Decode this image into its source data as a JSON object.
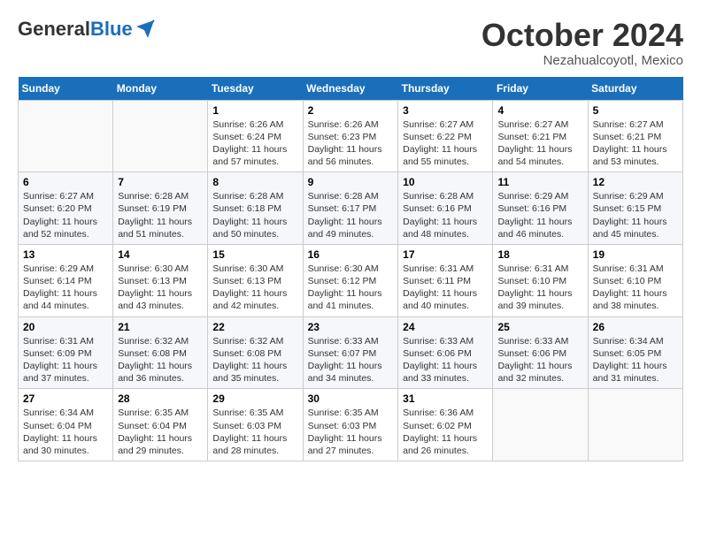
{
  "header": {
    "logo_general": "General",
    "logo_blue": "Blue",
    "month": "October 2024",
    "location": "Nezahualcoyotl, Mexico"
  },
  "days_of_week": [
    "Sunday",
    "Monday",
    "Tuesday",
    "Wednesday",
    "Thursday",
    "Friday",
    "Saturday"
  ],
  "weeks": [
    [
      {
        "day": "",
        "info": ""
      },
      {
        "day": "",
        "info": ""
      },
      {
        "day": "1",
        "info": "Sunrise: 6:26 AM\nSunset: 6:24 PM\nDaylight: 11 hours and 57 minutes."
      },
      {
        "day": "2",
        "info": "Sunrise: 6:26 AM\nSunset: 6:23 PM\nDaylight: 11 hours and 56 minutes."
      },
      {
        "day": "3",
        "info": "Sunrise: 6:27 AM\nSunset: 6:22 PM\nDaylight: 11 hours and 55 minutes."
      },
      {
        "day": "4",
        "info": "Sunrise: 6:27 AM\nSunset: 6:21 PM\nDaylight: 11 hours and 54 minutes."
      },
      {
        "day": "5",
        "info": "Sunrise: 6:27 AM\nSunset: 6:21 PM\nDaylight: 11 hours and 53 minutes."
      }
    ],
    [
      {
        "day": "6",
        "info": "Sunrise: 6:27 AM\nSunset: 6:20 PM\nDaylight: 11 hours and 52 minutes."
      },
      {
        "day": "7",
        "info": "Sunrise: 6:28 AM\nSunset: 6:19 PM\nDaylight: 11 hours and 51 minutes."
      },
      {
        "day": "8",
        "info": "Sunrise: 6:28 AM\nSunset: 6:18 PM\nDaylight: 11 hours and 50 minutes."
      },
      {
        "day": "9",
        "info": "Sunrise: 6:28 AM\nSunset: 6:17 PM\nDaylight: 11 hours and 49 minutes."
      },
      {
        "day": "10",
        "info": "Sunrise: 6:28 AM\nSunset: 6:16 PM\nDaylight: 11 hours and 48 minutes."
      },
      {
        "day": "11",
        "info": "Sunrise: 6:29 AM\nSunset: 6:16 PM\nDaylight: 11 hours and 46 minutes."
      },
      {
        "day": "12",
        "info": "Sunrise: 6:29 AM\nSunset: 6:15 PM\nDaylight: 11 hours and 45 minutes."
      }
    ],
    [
      {
        "day": "13",
        "info": "Sunrise: 6:29 AM\nSunset: 6:14 PM\nDaylight: 11 hours and 44 minutes."
      },
      {
        "day": "14",
        "info": "Sunrise: 6:30 AM\nSunset: 6:13 PM\nDaylight: 11 hours and 43 minutes."
      },
      {
        "day": "15",
        "info": "Sunrise: 6:30 AM\nSunset: 6:13 PM\nDaylight: 11 hours and 42 minutes."
      },
      {
        "day": "16",
        "info": "Sunrise: 6:30 AM\nSunset: 6:12 PM\nDaylight: 11 hours and 41 minutes."
      },
      {
        "day": "17",
        "info": "Sunrise: 6:31 AM\nSunset: 6:11 PM\nDaylight: 11 hours and 40 minutes."
      },
      {
        "day": "18",
        "info": "Sunrise: 6:31 AM\nSunset: 6:10 PM\nDaylight: 11 hours and 39 minutes."
      },
      {
        "day": "19",
        "info": "Sunrise: 6:31 AM\nSunset: 6:10 PM\nDaylight: 11 hours and 38 minutes."
      }
    ],
    [
      {
        "day": "20",
        "info": "Sunrise: 6:31 AM\nSunset: 6:09 PM\nDaylight: 11 hours and 37 minutes."
      },
      {
        "day": "21",
        "info": "Sunrise: 6:32 AM\nSunset: 6:08 PM\nDaylight: 11 hours and 36 minutes."
      },
      {
        "day": "22",
        "info": "Sunrise: 6:32 AM\nSunset: 6:08 PM\nDaylight: 11 hours and 35 minutes."
      },
      {
        "day": "23",
        "info": "Sunrise: 6:33 AM\nSunset: 6:07 PM\nDaylight: 11 hours and 34 minutes."
      },
      {
        "day": "24",
        "info": "Sunrise: 6:33 AM\nSunset: 6:06 PM\nDaylight: 11 hours and 33 minutes."
      },
      {
        "day": "25",
        "info": "Sunrise: 6:33 AM\nSunset: 6:06 PM\nDaylight: 11 hours and 32 minutes."
      },
      {
        "day": "26",
        "info": "Sunrise: 6:34 AM\nSunset: 6:05 PM\nDaylight: 11 hours and 31 minutes."
      }
    ],
    [
      {
        "day": "27",
        "info": "Sunrise: 6:34 AM\nSunset: 6:04 PM\nDaylight: 11 hours and 30 minutes."
      },
      {
        "day": "28",
        "info": "Sunrise: 6:35 AM\nSunset: 6:04 PM\nDaylight: 11 hours and 29 minutes."
      },
      {
        "day": "29",
        "info": "Sunrise: 6:35 AM\nSunset: 6:03 PM\nDaylight: 11 hours and 28 minutes."
      },
      {
        "day": "30",
        "info": "Sunrise: 6:35 AM\nSunset: 6:03 PM\nDaylight: 11 hours and 27 minutes."
      },
      {
        "day": "31",
        "info": "Sunrise: 6:36 AM\nSunset: 6:02 PM\nDaylight: 11 hours and 26 minutes."
      },
      {
        "day": "",
        "info": ""
      },
      {
        "day": "",
        "info": ""
      }
    ]
  ]
}
